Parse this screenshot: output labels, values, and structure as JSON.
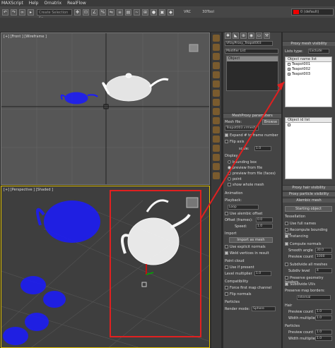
{
  "menu": [
    "MAXScript",
    "Help",
    "Ornatrix",
    "RealFlow"
  ],
  "toolbar": {
    "selection_set": "Create Selection Se",
    "label_vrc": "VRC",
    "label_3d": "3DTool",
    "layer": "0 (default)"
  },
  "viewports": {
    "top_label": "[+] [Front ] [Wireframe ]",
    "persp_label": "[+] [Perspective ] [Shaded ]"
  },
  "cmdpanel": {
    "object_name": "VRayProxy_Teapot003",
    "modifier_list": "Modifier List",
    "stack_item": "Object",
    "meshproxy_title": "MeshProxy parameters",
    "mesh_file_label": "Mesh file:",
    "mesh_file_value": "Teapot003.vrmesh",
    "browse": "Browse",
    "expand_label": "Expand # to frame number",
    "flip_axis": "Flip axis",
    "scale_label": "scale:",
    "scale_value": "1.0",
    "display_label": "Display",
    "display_opts": [
      "bounding box",
      "preview from file",
      "preview from file (faces)",
      "point",
      "show whole mesh"
    ],
    "animation_label": "Animation",
    "playback": "Playback:",
    "playback_value": "Loop",
    "use_alembic_offset": "Use alembic offset",
    "offset_label": "Offset (frames):",
    "offset_value": "0.0",
    "speed_label": "Speed:",
    "speed_value": "1.0",
    "import_label": "Import",
    "import_btn": "Import as mesh",
    "use_explicit": "Use explicit normals",
    "weld_vertices": "Weld vertices in result",
    "pointcloud_label": "Point cloud",
    "use_if_present": "Use if present",
    "level_mult_label": "Level multiplier",
    "level_mult_value": "1.0",
    "compat_label": "Compatibility",
    "force_first": "Force first map channel",
    "flip_normals": "Flip normals",
    "particles_label": "Particles",
    "render_mode_label": "Render mode:",
    "render_mode_value": "Sphere"
  },
  "rpanel": {
    "proxy_mesh_vis": "Proxy mesh visibility",
    "lists_type_label": "Lists type:",
    "lists_type_value": "Exclude",
    "object_name_list": "Object name list",
    "objects": [
      {
        "name": "Teapot001",
        "checked": false
      },
      {
        "name": "Teapot002",
        "checked": true
      },
      {
        "name": "Teapot003",
        "checked": true
      }
    ],
    "object_id_list": "Object id list",
    "id_items": [
      ""
    ],
    "proxy_hair_vis": "Proxy hair visibility",
    "proxy_particle_vis": "Proxy particle visibility",
    "alembic_mesh": "Alembic mesh",
    "starting_object": "Starting object",
    "tessellation": "Tessellation",
    "use_full_names": "Use full names",
    "recompute_bbox": "Recompute bounding box",
    "instancing": "Instancing",
    "compute_normals": "Compute normals",
    "smooth_angle": "Smooth angle",
    "smooth_angle_value": "30.0",
    "preview_count": "Preview count",
    "preview_count_value": "1000",
    "subdivide_all": "Subdivide all meshes",
    "subdivide_level": "Subdiv level",
    "subdiv_level_value": "4",
    "preserve_geom": "Preserve geometry borders",
    "subdivide_uvs": "Subdivide UVs",
    "preserve_map": "Preserve map borders:",
    "preserve_map_value": "Internal",
    "hair_label": "Hair",
    "preview_count2": "Preview count",
    "preview_count2_value": "1.0",
    "width_mult": "Width multiplier",
    "width_mult_value": "1.0",
    "particles_label": "Particles",
    "particle_count": "Preview count",
    "particle_count_value": "1.0",
    "particle_width": "Width multiplier",
    "particle_width_value": "1.0"
  },
  "colors": {
    "highlight": "#e02020",
    "wire_blue": "#1a1aff",
    "wire_white": "#ffffff"
  }
}
